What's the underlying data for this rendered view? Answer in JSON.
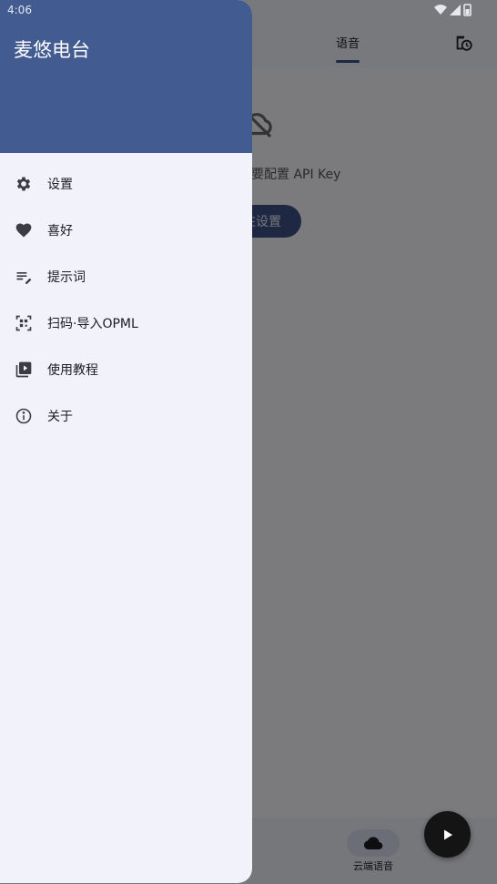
{
  "status_bar": {
    "time": "4:06"
  },
  "drawer": {
    "title": "麦悠电台",
    "items": [
      {
        "label": "设置",
        "icon": "gear-icon"
      },
      {
        "label": "喜好",
        "icon": "heart-icon"
      },
      {
        "label": "提示词",
        "icon": "edit-list-icon"
      },
      {
        "label": "扫码·导入OPML",
        "icon": "qr-scan-icon"
      },
      {
        "label": "使用教程",
        "icon": "video-library-icon"
      },
      {
        "label": "关于",
        "icon": "info-icon"
      }
    ]
  },
  "background": {
    "tab_label": "语音",
    "message_text": "要配置 API Key",
    "button_label": "往设置",
    "nav_label": "云端语音"
  },
  "colors": {
    "header": "#425b91",
    "drawer_bg": "#f2f2fb",
    "accent": "#3c5187",
    "fab": "#141414"
  }
}
